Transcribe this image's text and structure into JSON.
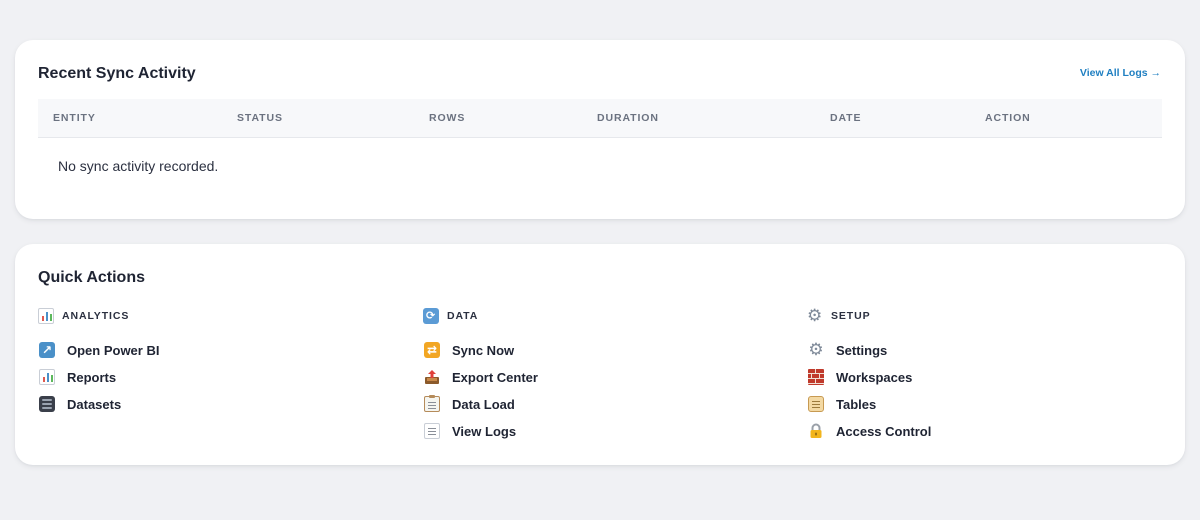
{
  "sync": {
    "title": "Recent Sync Activity",
    "view_all": "View All Logs →",
    "columns": [
      "ENTITY",
      "STATUS",
      "ROWS",
      "DURATION",
      "DATE",
      "ACTION"
    ],
    "empty_message": "No sync activity recorded."
  },
  "quick": {
    "title": "Quick Actions",
    "groups": [
      {
        "title": "ANALYTICS",
        "icon": "bar-chart-icon",
        "actions": [
          {
            "label": "Open Power BI",
            "icon": "external-arrow-icon"
          },
          {
            "label": "Reports",
            "icon": "bar-chart-icon"
          },
          {
            "label": "Datasets",
            "icon": "database-icon"
          }
        ]
      },
      {
        "title": "DATA",
        "icon": "refresh-icon",
        "actions": [
          {
            "label": "Sync Now",
            "icon": "sync-icon"
          },
          {
            "label": "Export Center",
            "icon": "outbox-tray-icon"
          },
          {
            "label": "Data Load",
            "icon": "clipboard-icon"
          },
          {
            "label": "View Logs",
            "icon": "bookmark-tabs-icon"
          }
        ]
      },
      {
        "title": "SETUP",
        "icon": "gear-icon",
        "actions": [
          {
            "label": "Settings",
            "icon": "gear-icon"
          },
          {
            "label": "Workspaces",
            "icon": "brick-icon"
          },
          {
            "label": "Tables",
            "icon": "scroll-icon"
          },
          {
            "label": "Access Control",
            "icon": "lock-icon"
          }
        ]
      }
    ]
  },
  "colors": {
    "background": "#f0f1f4",
    "card": "#ffffff",
    "link": "#1f7fc1",
    "header_bg": "#f7f8fa",
    "muted_text": "#6b7280"
  }
}
